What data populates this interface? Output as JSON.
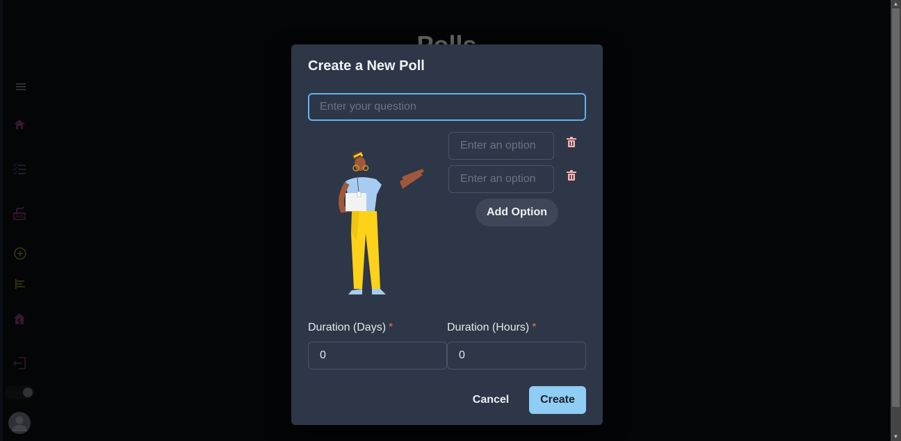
{
  "page": {
    "title": "Polls"
  },
  "sidebar": {
    "items": [
      {
        "name": "menu",
        "icon": "hamburger-menu-icon",
        "color": "#8a8f96"
      },
      {
        "name": "home",
        "icon": "home-icon",
        "color": "#8b3a7a"
      },
      {
        "name": "polls-list",
        "icon": "checklist-icon",
        "color": "#3b4f73"
      },
      {
        "name": "vote",
        "icon": "ballot-box-icon",
        "color": "#8b3a7a"
      },
      {
        "name": "create-poll",
        "icon": "plus-circle-icon",
        "color": "#8f8f1a"
      },
      {
        "name": "results",
        "icon": "bar-chart-icon",
        "color": "#8f8f1a"
      },
      {
        "name": "broken-home",
        "icon": "broken-home-icon",
        "color": "#8b3a7a"
      },
      {
        "name": "logout",
        "icon": "logout-icon",
        "color": "#8b3a7a"
      }
    ],
    "theme_toggle": {
      "state": "on"
    },
    "avatar": "user-avatar-icon"
  },
  "modal": {
    "title": "Create a New Poll",
    "question": {
      "value": "",
      "placeholder": "Enter your question"
    },
    "options": [
      {
        "value": "",
        "placeholder": "Enter an option"
      },
      {
        "value": "",
        "placeholder": "Enter an option"
      }
    ],
    "add_option_label": "Add Option",
    "duration_days": {
      "label": "Duration (Days)",
      "required_mark": "*",
      "value": "0"
    },
    "duration_hours": {
      "label": "Duration (Hours)",
      "required_mark": "*",
      "value": "0"
    },
    "cancel_label": "Cancel",
    "create_label": "Create"
  },
  "colors": {
    "accent": "#63b3ed",
    "primary_button": "#90cdf4",
    "danger": "#feb2b2",
    "modal_bg": "#2d3748"
  }
}
